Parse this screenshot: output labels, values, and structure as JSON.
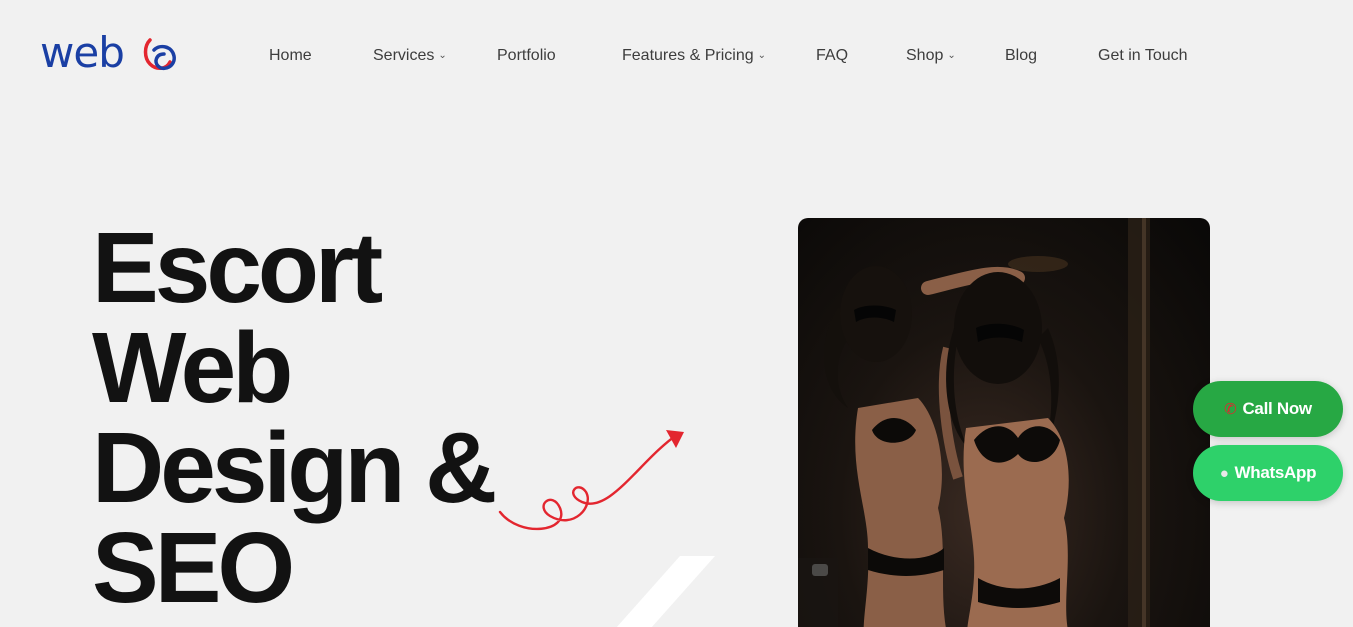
{
  "brand": {
    "logo_text": "web",
    "accent_blue": "#1a3fa4",
    "accent_red": "#e3262f"
  },
  "nav": {
    "items": [
      {
        "label": "Home",
        "has_dropdown": false
      },
      {
        "label": "Services",
        "has_dropdown": true
      },
      {
        "label": "Portfolio",
        "has_dropdown": false
      },
      {
        "label": "Features & Pricing",
        "has_dropdown": true
      },
      {
        "label": "FAQ",
        "has_dropdown": false
      },
      {
        "label": "Shop",
        "has_dropdown": true
      },
      {
        "label": "Blog",
        "has_dropdown": false
      },
      {
        "label": "Get in Touch",
        "has_dropdown": false
      }
    ],
    "chevron_icon": "chevron-down-icon"
  },
  "hero": {
    "title_lines": [
      "Escort",
      "Web",
      "Design &",
      "SEO"
    ],
    "decor_icon": "squiggle-arrow-icon",
    "image_icon": "hero-photo"
  },
  "floating": {
    "call_label": "Call Now",
    "call_icon": "phone-icon",
    "whatsapp_label": "WhatsApp",
    "whatsapp_icon": "chat-bubble-icon",
    "call_color": "#27a844",
    "whatsapp_color": "#2ed16a"
  }
}
